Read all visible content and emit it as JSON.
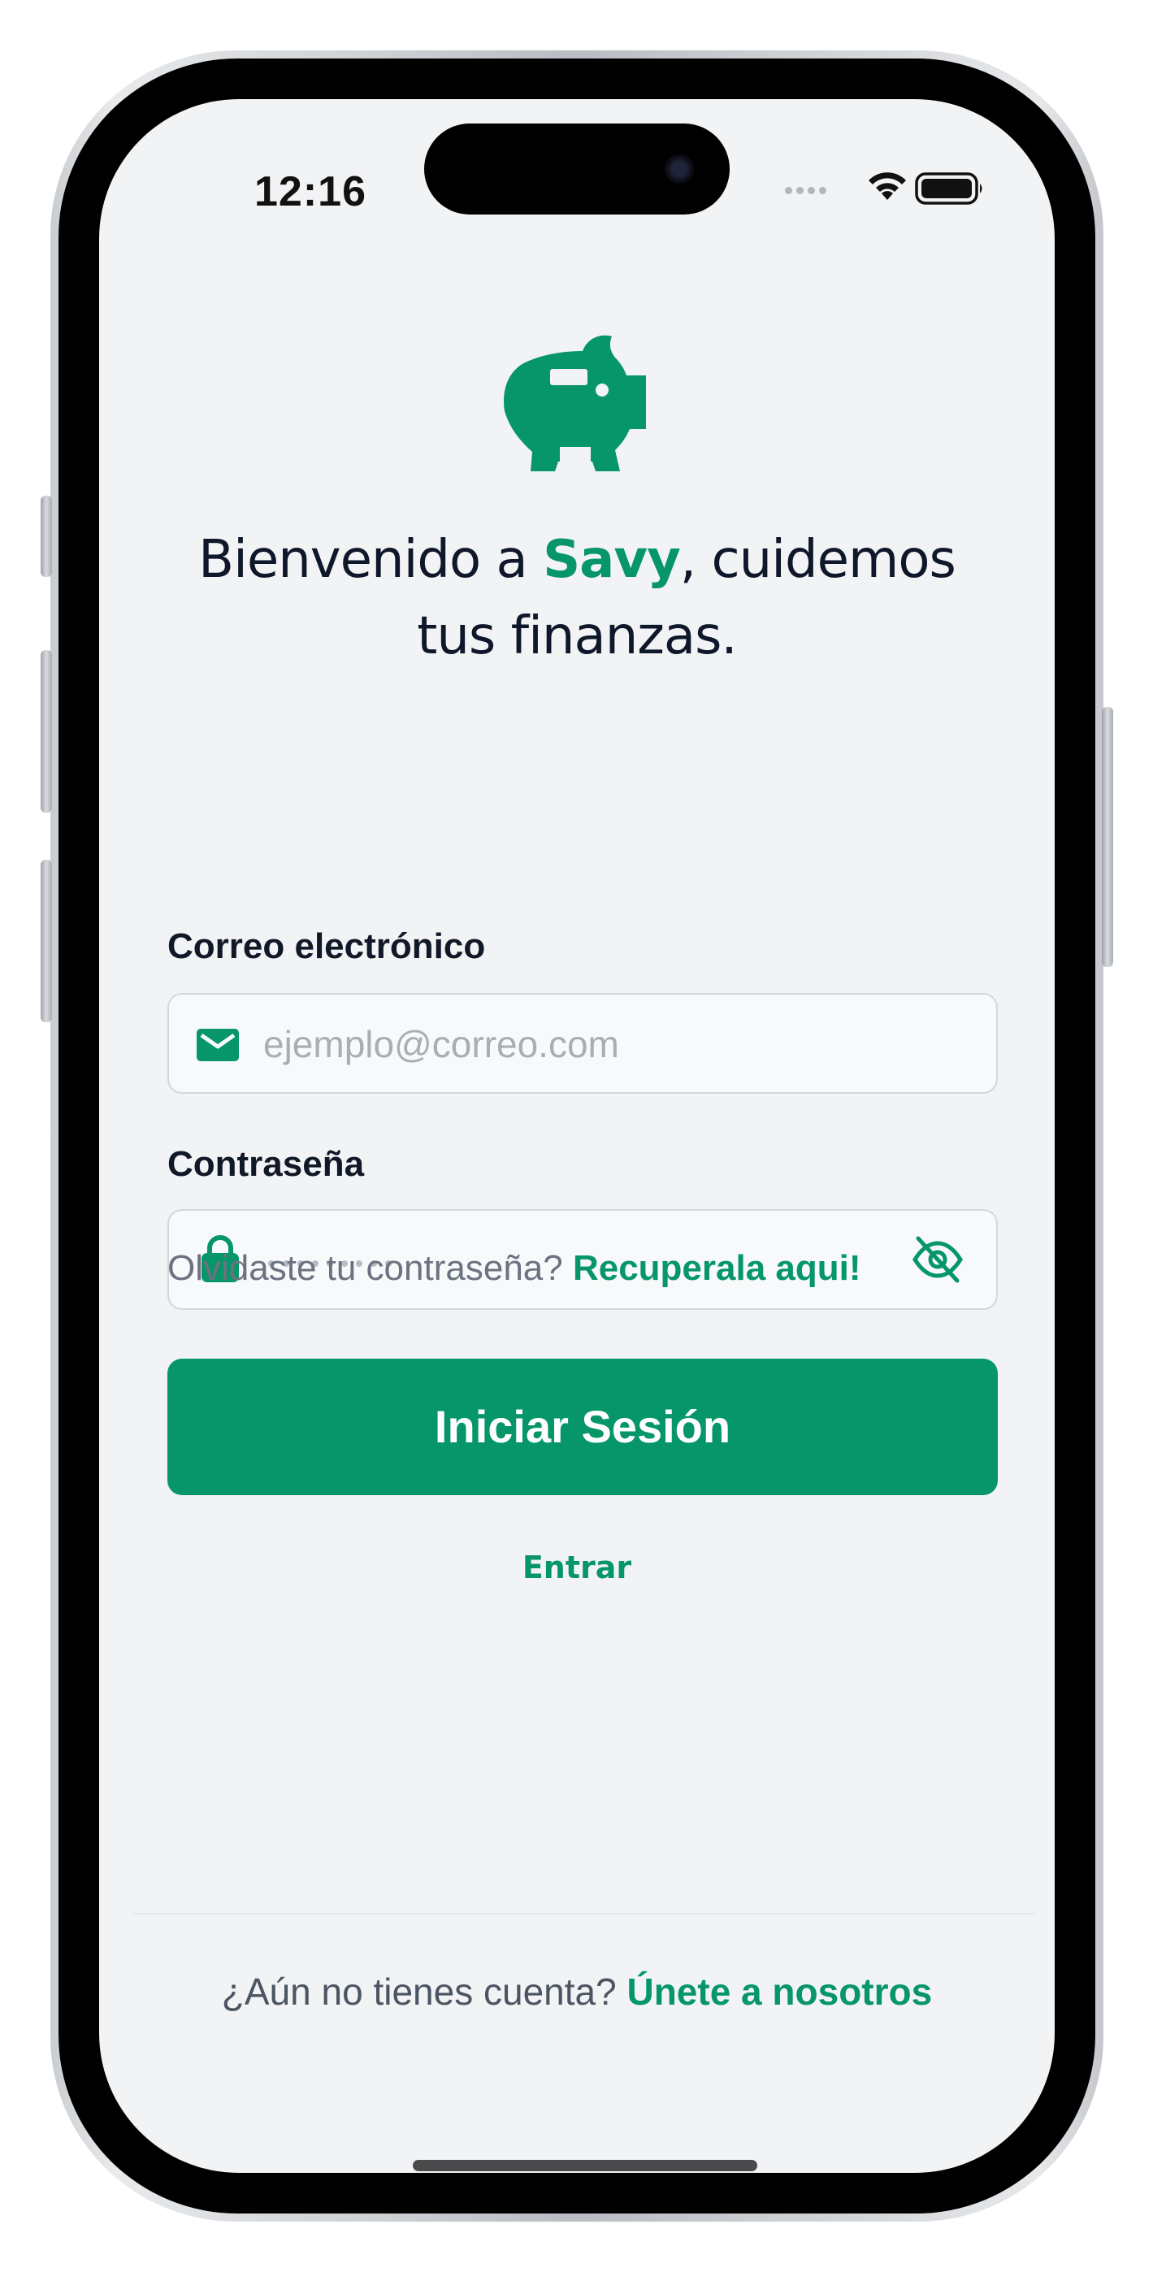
{
  "status_bar": {
    "time": "12:16",
    "icons": [
      "cellular-dots-icon",
      "wifi-icon",
      "battery-icon"
    ]
  },
  "brand": {
    "logo_icon": "piggy-bank-icon",
    "accent_color": "#079669"
  },
  "welcome": {
    "prefix": "Bienvenido a ",
    "brand_name": "Savy",
    "suffix": ", cuidemos tus finanzas."
  },
  "form": {
    "email": {
      "label": "Correo electrónico",
      "placeholder": "ejemplo@correo.com",
      "icon": "envelope-icon"
    },
    "password": {
      "label": "Contraseña",
      "masked_placeholder": "•••••••••",
      "icon": "lock-icon",
      "toggle_icon": "eye-slash-icon"
    },
    "forgot": {
      "text": "Olvidaste tu contraseña? ",
      "link": "Recuperala aqui!"
    },
    "submit_label": "Iniciar Sesión",
    "secondary_label": "Entrar"
  },
  "footer": {
    "text": "¿Aún no tienes cuenta? ",
    "link": "Únete a nosotros"
  }
}
